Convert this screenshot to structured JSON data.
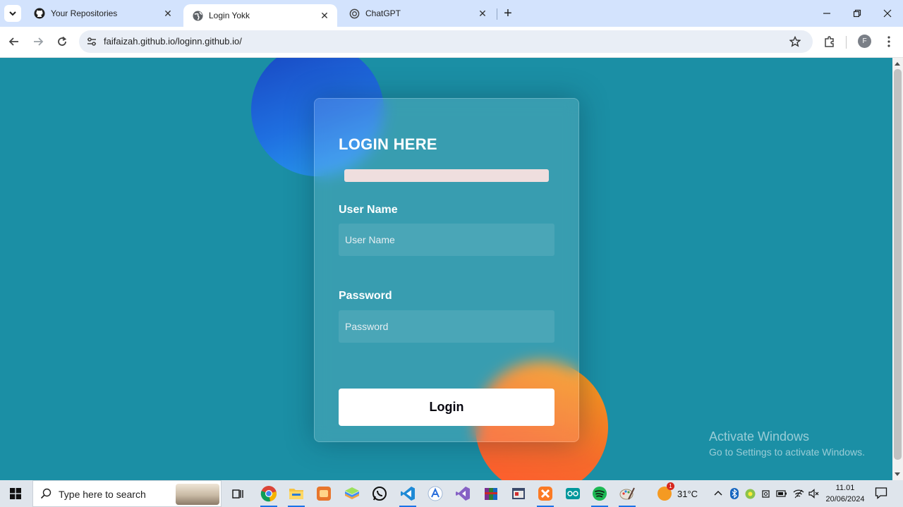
{
  "browser": {
    "tabs": [
      {
        "title": "Your Repositories",
        "active": false,
        "icon": "github-icon"
      },
      {
        "title": "Login Yokk",
        "active": true,
        "icon": "globe-icon"
      },
      {
        "title": "ChatGPT",
        "active": false,
        "icon": "chatgpt-icon"
      }
    ],
    "url": "faifaizah.github.io/loginn.github.io/",
    "profile_initial": "F"
  },
  "login": {
    "title": "LOGIN HERE",
    "username_label": "User Name",
    "username_placeholder": "User Name",
    "username_value": "",
    "password_label": "Password",
    "password_placeholder": "Password",
    "password_value": "",
    "button_label": "Login"
  },
  "watermark": {
    "line1": "Activate Windows",
    "line2": "Go to Settings to activate Windows."
  },
  "taskbar": {
    "search_placeholder": "Type here to search",
    "weather": "31°C",
    "weather_badge": "1",
    "time": "11.01",
    "date": "20/06/2024",
    "apps": [
      "task-view-icon",
      "chrome-icon",
      "file-explorer-icon",
      "app-orange-icon",
      "bluestacks-icon",
      "whatsapp-icon",
      "vscode-icon",
      "arduino-ide-icon",
      "visual-studio-icon",
      "winrar-icon",
      "app-window-icon",
      "xampp-icon",
      "arduino-icon",
      "spotify-icon",
      "paint-icon"
    ]
  },
  "colors": {
    "page_bg": "#1b8fa5",
    "blob_blue": "#1f6fe0",
    "blob_orange": "#f66a2c",
    "tabstrip_bg": "#d3e3fd"
  }
}
